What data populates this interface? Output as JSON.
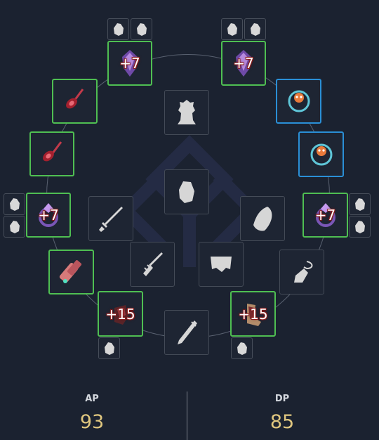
{
  "equipment": {
    "enhancements": {
      "earring_left": "+7",
      "earring_right": "+7",
      "ring_left": "+7",
      "ring_right": "+7",
      "gloves": "+15",
      "shoes": "+15"
    }
  },
  "stats": {
    "ap": {
      "label": "AP",
      "value": "93"
    },
    "dp": {
      "label": "DP",
      "value": "85"
    }
  },
  "colors": {
    "background": "#1b2230",
    "equipped_border": "#4fbf52",
    "pet_border": "#2a8fd6",
    "enhance_text": "#ffffff",
    "stat_value": "#e0c77f"
  }
}
